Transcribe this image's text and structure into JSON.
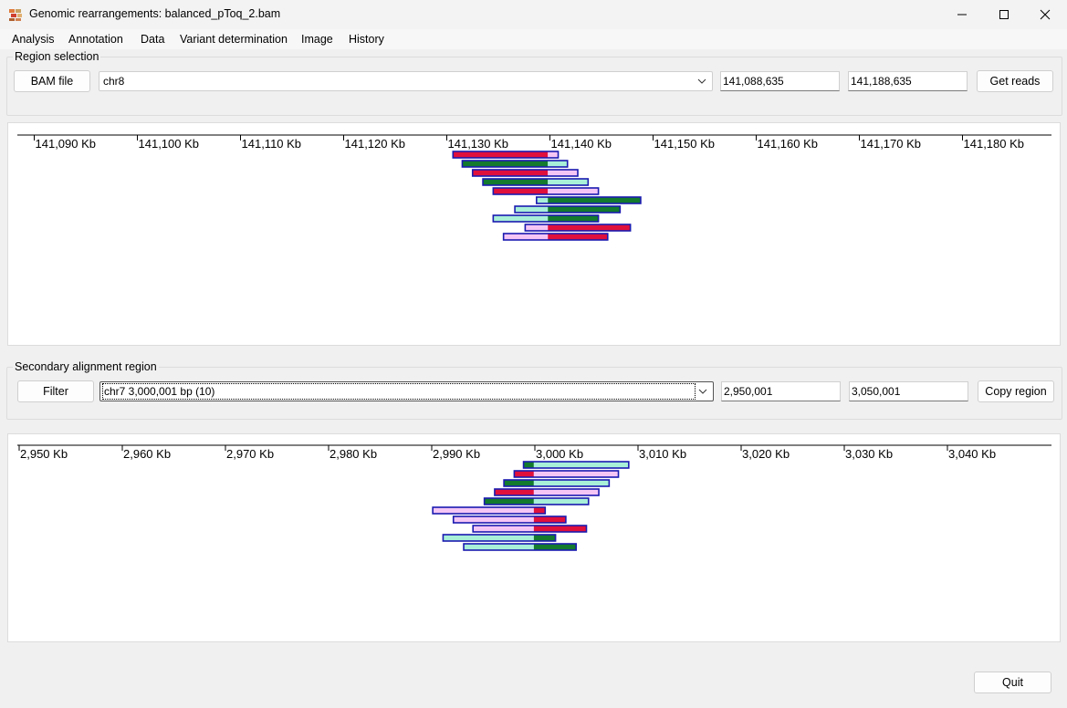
{
  "window": {
    "title": "Genomic rearrangements: balanced_pToq_2.bam"
  },
  "menu": [
    "Analysis",
    "Annotation",
    "Data",
    "Variant determination",
    "Image",
    "History"
  ],
  "region_selection": {
    "label": "Region selection",
    "bam_button": "BAM file",
    "chromosome": "chr8",
    "start": "141,088,635",
    "end": "141,188,635",
    "get_reads_button": "Get reads"
  },
  "secondary": {
    "label": "Secondary alignment region",
    "filter_button": "Filter",
    "region": "chr7 3,000,001 bp (10)",
    "start": "2,950,001",
    "end": "3,050,001",
    "copy_button": "Copy region"
  },
  "quit_button": "Quit",
  "colors": {
    "red": "#e0103c",
    "dark_green": "#137a2e",
    "light_teal": "#a8f0d8",
    "light_pink": "#f5c6f5",
    "outline": "#1a1ab0"
  },
  "top_track": {
    "ticks": [
      "141,090 Kb",
      "141,100 Kb",
      "141,110 Kb",
      "141,120 Kb",
      "141,130 Kb",
      "141,140 Kb",
      "141,150 Kb",
      "141,160 Kb",
      "141,170 Kb",
      "141,180 Kb"
    ],
    "reads": [
      {
        "start_kb": 141130.6,
        "break_kb": 141139.8,
        "end_kb": 141140.8,
        "left": "red",
        "right": "light_pink"
      },
      {
        "start_kb": 141131.5,
        "break_kb": 141139.8,
        "end_kb": 141141.7,
        "left": "dark_green",
        "right": "light_teal"
      },
      {
        "start_kb": 141132.5,
        "break_kb": 141139.8,
        "end_kb": 141142.7,
        "left": "red",
        "right": "light_pink"
      },
      {
        "start_kb": 141133.5,
        "break_kb": 141139.8,
        "end_kb": 141143.7,
        "left": "dark_green",
        "right": "light_teal"
      },
      {
        "start_kb": 141134.5,
        "break_kb": 141139.8,
        "end_kb": 141144.7,
        "left": "red",
        "right": "light_pink"
      },
      {
        "start_kb": 141138.7,
        "break_kb": 141139.8,
        "end_kb": 141148.8,
        "left": "light_teal",
        "right": "dark_green"
      },
      {
        "start_kb": 141136.6,
        "break_kb": 141139.8,
        "end_kb": 141146.8,
        "left": "light_teal",
        "right": "dark_green"
      },
      {
        "start_kb": 141134.5,
        "break_kb": 141139.8,
        "end_kb": 141144.7,
        "left": "light_teal",
        "right": "dark_green"
      },
      {
        "start_kb": 141137.6,
        "break_kb": 141139.8,
        "end_kb": 141147.8,
        "left": "light_pink",
        "right": "red"
      },
      {
        "start_kb": 141135.5,
        "break_kb": 141139.8,
        "end_kb": 141145.6,
        "left": "light_pink",
        "right": "red"
      }
    ]
  },
  "bottom_track": {
    "ticks": [
      "2,950 Kb",
      "2,960 Kb",
      "2,970 Kb",
      "2,980 Kb",
      "2,990 Kb",
      "3,000 Kb",
      "3,010 Kb",
      "3,020 Kb",
      "3,030 Kb",
      "3,040 Kb"
    ],
    "reads": [
      {
        "start_kb": 2998.9,
        "break_kb": 2999.9,
        "end_kb": 3009.1,
        "left": "dark_green",
        "right": "light_teal"
      },
      {
        "start_kb": 2998.0,
        "break_kb": 2999.9,
        "end_kb": 3008.1,
        "left": "red",
        "right": "light_pink"
      },
      {
        "start_kb": 2997.0,
        "break_kb": 2999.9,
        "end_kb": 3007.2,
        "left": "dark_green",
        "right": "light_teal"
      },
      {
        "start_kb": 2996.1,
        "break_kb": 2999.9,
        "end_kb": 3006.2,
        "left": "red",
        "right": "light_pink"
      },
      {
        "start_kb": 2995.1,
        "break_kb": 2999.9,
        "end_kb": 3005.2,
        "left": "dark_green",
        "right": "light_teal"
      },
      {
        "start_kb": 2990.1,
        "break_kb": 2999.9,
        "end_kb": 3001.0,
        "left": "light_pink",
        "right": "red"
      },
      {
        "start_kb": 2992.1,
        "break_kb": 2999.9,
        "end_kb": 3003.0,
        "left": "light_pink",
        "right": "red"
      },
      {
        "start_kb": 2994.0,
        "break_kb": 2999.9,
        "end_kb": 3005.0,
        "left": "light_pink",
        "right": "red"
      },
      {
        "start_kb": 2991.1,
        "break_kb": 2999.9,
        "end_kb": 3002.0,
        "left": "light_teal",
        "right": "dark_green"
      },
      {
        "start_kb": 2993.1,
        "break_kb": 2999.9,
        "end_kb": 3004.0,
        "left": "light_teal",
        "right": "dark_green"
      }
    ]
  }
}
